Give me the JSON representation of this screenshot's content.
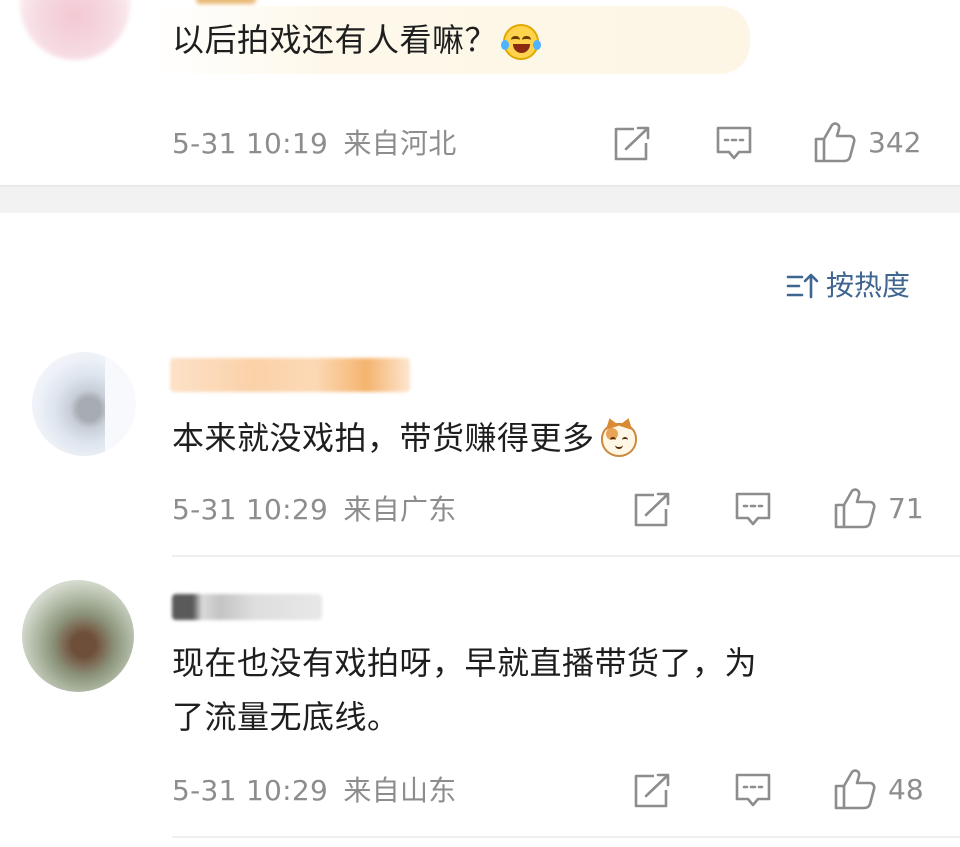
{
  "sort": {
    "label": "按热度"
  },
  "comments": [
    {
      "text": "以后拍戏还有人看嘛？",
      "emoji": "laughing-crying-emoji",
      "date": "5-31 10:19",
      "place": "来自河北",
      "likes": "342"
    },
    {
      "text": "本来就没戏拍，带货赚得更多",
      "emoji": "cat-emoji",
      "date": "5-31 10:29",
      "place": "来自广东",
      "likes": "71"
    },
    {
      "text_line1": "现在也没有戏拍呀，早就直播带货了，为",
      "text_line2": "了流量无底线。",
      "date": "5-31 10:29",
      "place": "来自山东",
      "likes": "48"
    }
  ],
  "icons": {
    "share": "share-icon",
    "comment": "comment-icon",
    "like": "thumbs-up-icon",
    "sort": "sort-icon"
  },
  "colors": {
    "meta_gray": "#8d8d8d",
    "sort_blue": "#3f6591",
    "text": "#1e1e1e",
    "section_band": "#f2f2f2"
  }
}
